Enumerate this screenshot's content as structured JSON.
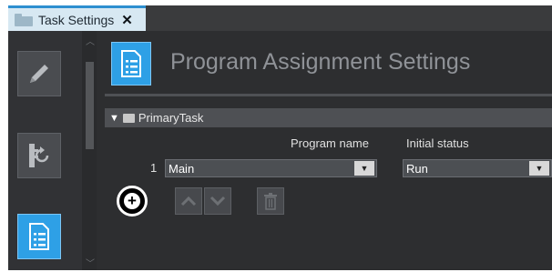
{
  "tab": {
    "label": "Task Settings",
    "close": "✕"
  },
  "header": {
    "title": "Program Assignment Settings"
  },
  "section": {
    "name": "PrimaryTask"
  },
  "table": {
    "columns": [
      "Program name",
      "Initial status"
    ],
    "rows": [
      {
        "index": "1",
        "program": "Main",
        "status": "Run"
      }
    ]
  },
  "toolbar": {
    "add": "+",
    "up": "▲",
    "down": "▼",
    "delete": "trash-icon"
  },
  "colors": {
    "accent": "#2ea0e6",
    "tab_bg": "#d7e8f2",
    "panel": "#2d2e30"
  }
}
